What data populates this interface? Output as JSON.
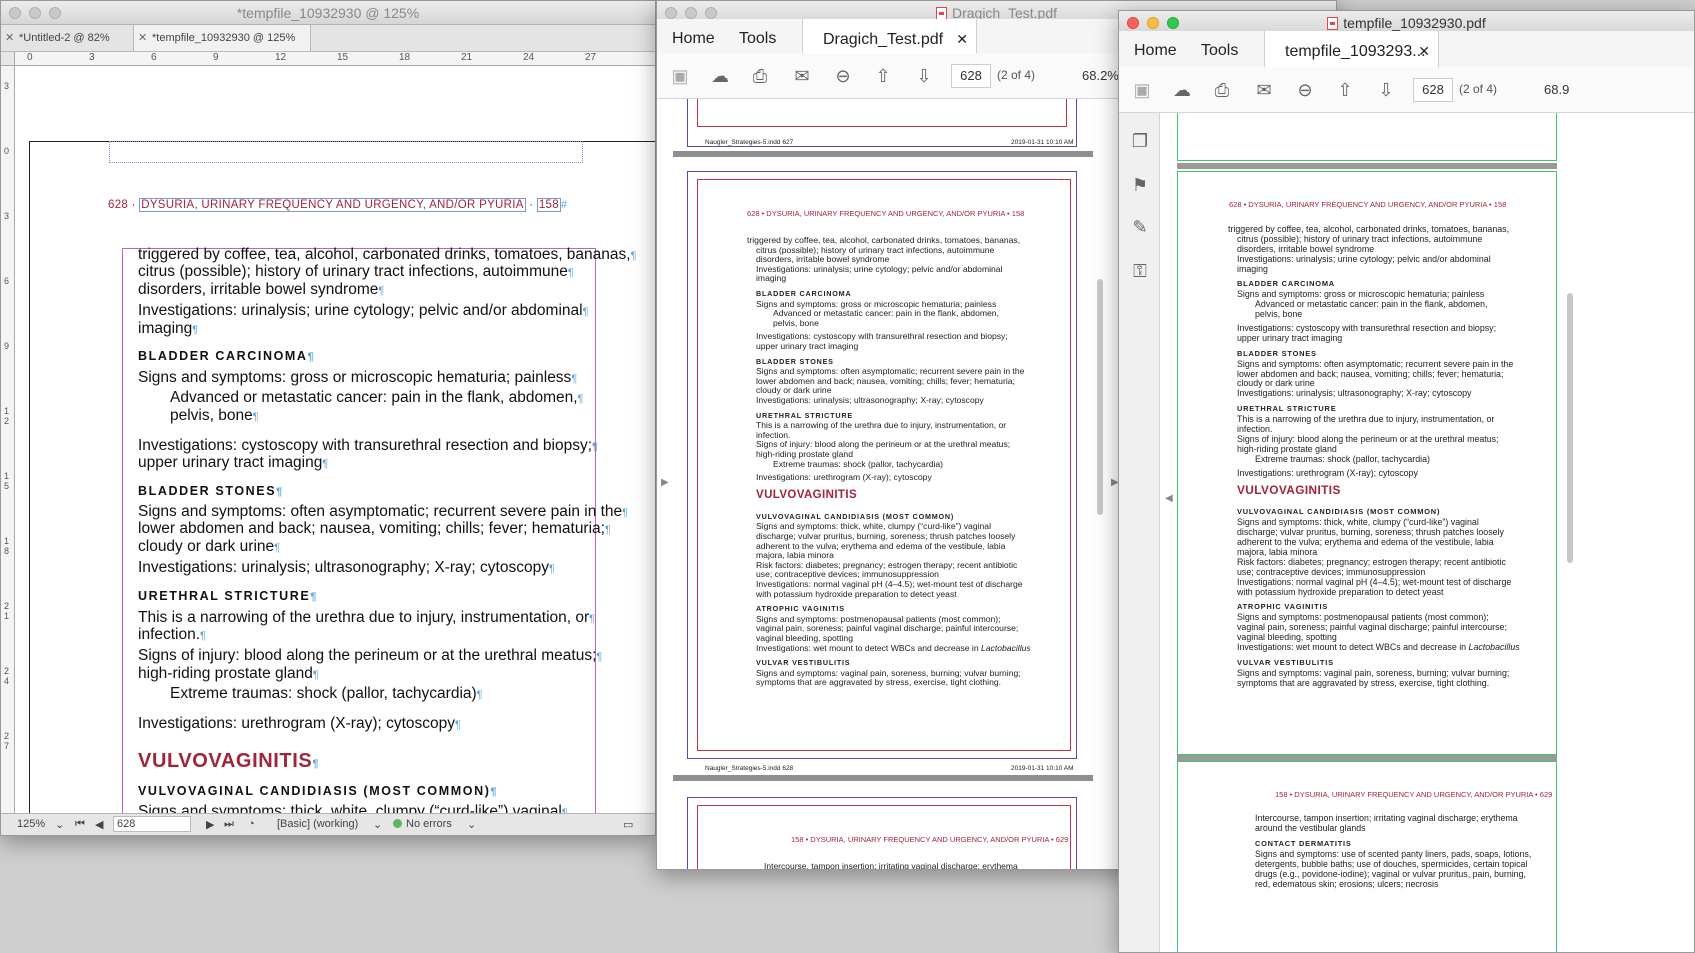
{
  "indesign": {
    "title": "*tempfile_10932930 @ 125%",
    "tabs": [
      "*Untitled-2 @ 82%",
      "*tempfile_10932930 @ 125%"
    ],
    "ruler_h": [
      "0",
      "3",
      "6",
      "9",
      "12",
      "15",
      "18",
      "21",
      "24",
      "27"
    ],
    "ruler_v": [
      "3",
      "0",
      "3",
      "6",
      "9",
      "1\n2",
      "1\n5",
      "1\n8",
      "2\n1",
      "2\n4",
      "2\n7"
    ],
    "header": {
      "page": "628",
      "title": "DYSURIA, URINARY FREQUENCY AND URGENCY, AND/OR PYURIA",
      "folio": "158"
    },
    "lines": [
      {
        "t": "triggered by coffee, tea, alcohol, carbonated drinks, tomatoes, bananas,",
        "k": "b"
      },
      {
        "t": "citrus (possible); history of urinary tract infections, autoimmune",
        "k": "b"
      },
      {
        "t": "disorders, irritable bowel syndrome",
        "k": "b"
      },
      {
        "t": "Investigations: urinalysis; urine cytology; pelvic and/or abdominal",
        "k": "b"
      },
      {
        "t": "imaging",
        "k": "b"
      },
      {
        "t": "BLADDER CARCINOMA",
        "k": "h"
      },
      {
        "t": "Signs and symptoms: gross or microscopic hematuria; painless",
        "k": "b"
      },
      {
        "t": "Advanced or metastatic cancer: pain in the flank, abdomen,",
        "k": "s"
      },
      {
        "t": "pelvis, bone",
        "k": "s"
      },
      {
        "t": "Investigations: cystoscopy with transurethral resection and biopsy;",
        "k": "b"
      },
      {
        "t": "upper urinary tract imaging",
        "k": "b"
      },
      {
        "t": "BLADDER STONES",
        "k": "h"
      },
      {
        "t": "Signs and symptoms: often asymptomatic; recurrent severe pain in the",
        "k": "b"
      },
      {
        "t": "lower abdomen and back; nausea, vomiting; chills; fever; hematuria;",
        "k": "b"
      },
      {
        "t": "cloudy or dark urine",
        "k": "b"
      },
      {
        "t": "Investigations: urinalysis; ultrasonography; X-ray; cytoscopy",
        "k": "b"
      },
      {
        "t": "URETHRAL STRICTURE",
        "k": "h"
      },
      {
        "t": "This is a narrowing of the urethra due to injury, instrumentation, or",
        "k": "b"
      },
      {
        "t": "infection.",
        "k": "b"
      },
      {
        "t": "Signs of injury: blood along the perineum or at the urethral meatus;",
        "k": "b"
      },
      {
        "t": "high-riding prostate gland",
        "k": "b"
      },
      {
        "t": "Extreme traumas: shock (pallor, tachycardia)",
        "k": "s"
      },
      {
        "t": "Investigations: urethrogram (X-ray); cytoscopy",
        "k": "b"
      },
      {
        "t": "VULVOVAGINITIS",
        "k": "g"
      },
      {
        "t": "VULVOVAGINAL CANDIDIASIS (MOST COMMON)",
        "k": "h"
      },
      {
        "t": "Signs and symptoms: thick, white, clumpy (“curd-like”) vaginal",
        "k": "b"
      }
    ],
    "status": {
      "zoom": "125%",
      "page": "628",
      "style": "[Basic] (working)",
      "errors": "No errors"
    }
  },
  "pdf1": {
    "title": "Dragich_Test.pdf",
    "home": "Home",
    "tools": "Tools",
    "tab": "Dragich_Test.pdf",
    "page": "628",
    "of": "(2 of 4)",
    "zoom": "68.2%",
    "slug_file_a": "Naugler_Strategies-5.indd   627",
    "slug_date_a": "2019-01-31   10:10 AM",
    "slug_file_b": "Naugler_Strategies-5.indd   628",
    "slug_date_b": "2019-01-31   10:10 AM",
    "header": "628 • DYSURIA, URINARY FREQUENCY AND URGENCY, AND/OR PYURIA • 158",
    "header_next": "158 • DYSURIA, URINARY FREQUENCY AND URGENCY, AND/OR PYURIA • 629",
    "next_line": "Intercourse, tampon insertion; irritating vaginal discharge; erythema"
  },
  "pdf2": {
    "title": "tempfile_10932930.pdf",
    "home": "Home",
    "tools": "Tools",
    "tab": "tempfile_1093293...",
    "page": "628",
    "of": "(2 of 4)",
    "zoom": "68.9",
    "header": "628 • DYSURIA, URINARY FREQUENCY AND URGENCY, AND/OR PYURIA • 158",
    "header_next": "158 • DYSURIA, URINARY FREQUENCY AND URGENCY, AND/OR PYURIA • 629",
    "next_lines": [
      "Intercourse, tampon insertion; irritating vaginal discharge; erythema",
      "around the vestibular glands",
      "CONTACT DERMATITIS",
      "Signs and symptoms: use of scented panty liners, pads, soaps, lotions,",
      "detergents, bubble baths; use of douches, spermicides, certain topical",
      "drugs (e.g., povidone-iodine); vaginal or vulvar pruritus, pain, burning,",
      "red, edematous skin; erosions; ulcers; necrosis"
    ]
  },
  "pdf_lines": [
    {
      "t": "triggered by coffee, tea, alcohol, carbonated drinks, tomatoes, bananas,",
      "k": "b0"
    },
    {
      "t": "citrus (possible); history of urinary tract infections, autoimmune",
      "k": "b"
    },
    {
      "t": "disorders, irritable bowel syndrome",
      "k": "b"
    },
    {
      "t": "Investigations: urinalysis; urine cytology; pelvic and/or abdominal",
      "k": "b"
    },
    {
      "t": "imaging",
      "k": "b"
    },
    {
      "t": "BLADDER CARCINOMA",
      "k": "h"
    },
    {
      "t": "Signs and symptoms: gross or microscopic hematuria; painless",
      "k": "b"
    },
    {
      "t": "Advanced or metastatic cancer: pain in the flank, abdomen,",
      "k": "s"
    },
    {
      "t": "pelvis, bone",
      "k": "s"
    },
    {
      "t": "Investigations: cystoscopy with transurethral resection and biopsy;",
      "k": "b"
    },
    {
      "t": "upper urinary tract imaging",
      "k": "b"
    },
    {
      "t": "BLADDER STONES",
      "k": "h"
    },
    {
      "t": "Signs and symptoms: often asymptomatic; recurrent severe pain in the",
      "k": "b"
    },
    {
      "t": "lower abdomen and back; nausea, vomiting; chills; fever; hematuria;",
      "k": "b"
    },
    {
      "t": "cloudy or dark urine",
      "k": "b"
    },
    {
      "t": "Investigations: urinalysis; ultrasonography; X-ray; cytoscopy",
      "k": "b"
    },
    {
      "t": "URETHRAL STRICTURE",
      "k": "h"
    },
    {
      "t": "This is a narrowing of the urethra due to injury, instrumentation, or",
      "k": "b"
    },
    {
      "t": "infection.",
      "k": "b"
    },
    {
      "t": "Signs of injury: blood along the perineum or at the urethral meatus;",
      "k": "b"
    },
    {
      "t": "high-riding prostate gland",
      "k": "b"
    },
    {
      "t": "Extreme traumas: shock (pallor, tachycardia)",
      "k": "s"
    },
    {
      "t": "Investigations: urethrogram (X-ray); cytoscopy",
      "k": "b"
    },
    {
      "t": "VULVOVAGINITIS",
      "k": "g"
    },
    {
      "t": "VULVOVAGINAL CANDIDIASIS (MOST COMMON)",
      "k": "h"
    },
    {
      "t": "Signs and symptoms: thick, white, clumpy (“curd-like”) vaginal",
      "k": "b"
    },
    {
      "t": "discharge; vulvar pruritus, burning, soreness; thrush patches loosely",
      "k": "b"
    },
    {
      "t": "adherent to the vulva; erythema and edema of the vestibule, labia",
      "k": "b"
    },
    {
      "t": "majora, labia minora",
      "k": "b"
    },
    {
      "t": "Risk factors: diabetes; pregnancy; estrogen therapy; recent antibiotic",
      "k": "b"
    },
    {
      "t": "use; contraceptive devices; immunosuppression",
      "k": "b"
    },
    {
      "t": "Investigations: normal vaginal pH (4–4.5); wet-mount test of discharge",
      "k": "b"
    },
    {
      "t": "with potassium hydroxide preparation to detect yeast",
      "k": "b"
    },
    {
      "t": "ATROPHIC VAGINITIS",
      "k": "h"
    },
    {
      "t": "Signs and symptoms: postmenopausal patients (most common);",
      "k": "b"
    },
    {
      "t": "vaginal pain, soreness; painful vaginal discharge; painful intercourse;",
      "k": "b"
    },
    {
      "t": "vaginal bleeding, spotting",
      "k": "b"
    },
    {
      "t": "Investigations: wet mount to detect WBCs and decrease in Lactobacillus",
      "k": "b"
    },
    {
      "t": "VULVAR VESTIBULITIS",
      "k": "h"
    },
    {
      "t": "Signs and symptoms: vaginal pain, soreness, burning; vulvar burning;",
      "k": "b"
    },
    {
      "t": "symptoms that are aggravated by stress, exercise, tight clothing.",
      "k": "b"
    }
  ]
}
